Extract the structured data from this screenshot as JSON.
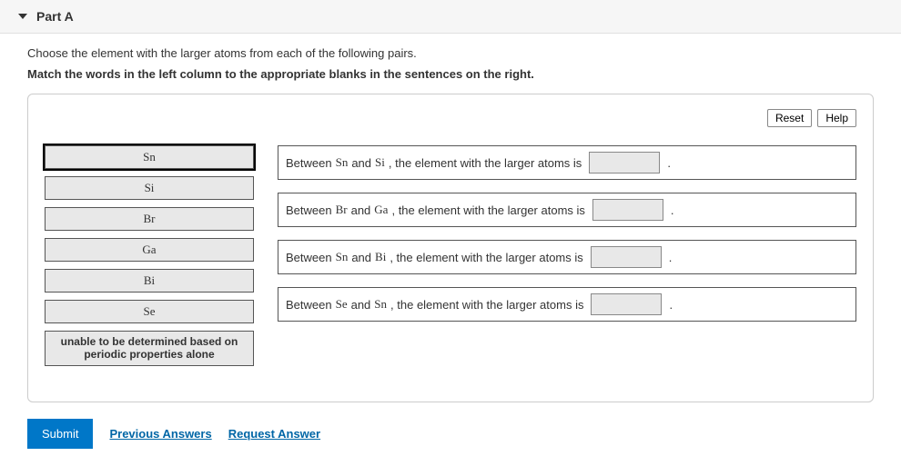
{
  "header": {
    "title": "Part A"
  },
  "prompt": "Choose the element with the larger atoms from each of the following pairs.",
  "instruction": "Match the words in the left column to the appropriate blanks in the sentences on the right.",
  "toolbar": {
    "reset": "Reset",
    "help": "Help"
  },
  "words": [
    {
      "label": "Sn",
      "chem": true,
      "selected": true
    },
    {
      "label": "Si",
      "chem": true
    },
    {
      "label": "Br",
      "chem": true
    },
    {
      "label": "Ga",
      "chem": true
    },
    {
      "label": "Bi",
      "chem": true
    },
    {
      "label": "Se",
      "chem": true
    },
    {
      "label": "unable to be determined based on periodic properties alone",
      "chem": false,
      "long": true
    }
  ],
  "sentences": [
    {
      "pre": "Between ",
      "a": "Sn",
      "mid": " and ",
      "b": "Si",
      "post": ", the element with the larger atoms is ",
      "tail": " ."
    },
    {
      "pre": "Between ",
      "a": "Br",
      "mid": " and ",
      "b": "Ga",
      "post": ", the element with the larger atoms is ",
      "tail": " ."
    },
    {
      "pre": "Between ",
      "a": "Sn",
      "mid": " and ",
      "b": "Bi",
      "post": ", the element with the larger atoms is ",
      "tail": " ."
    },
    {
      "pre": "Between ",
      "a": "Se",
      "mid": " and ",
      "b": "Sn",
      "post": ", the element with the larger atoms is ",
      "tail": " ."
    }
  ],
  "footer": {
    "submit": "Submit",
    "previous": "Previous Answers",
    "request": "Request Answer"
  }
}
